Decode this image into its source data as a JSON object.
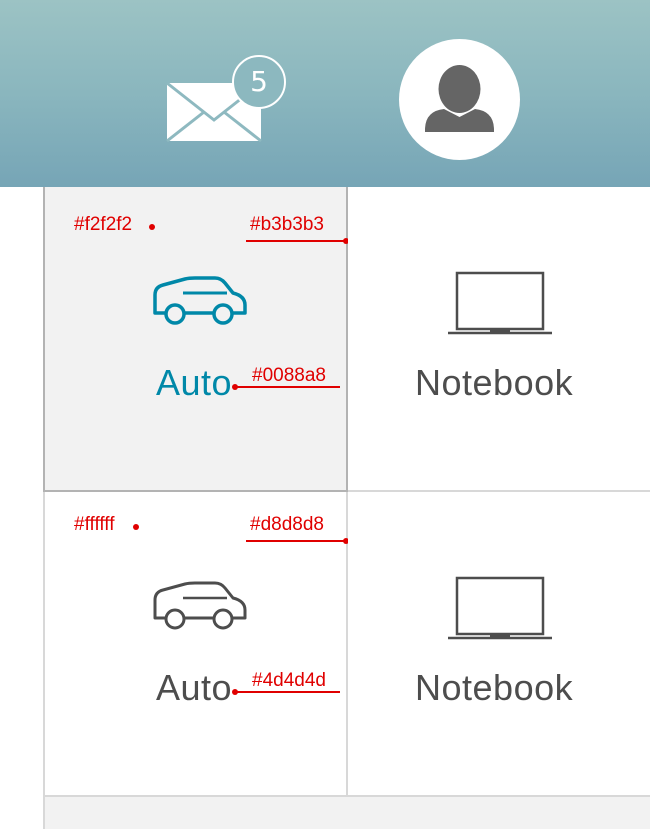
{
  "header": {
    "mail_badge_count": "5",
    "mail_icon": "envelope-icon",
    "avatar_icon": "user-silhouette-icon"
  },
  "tiles": [
    {
      "label": "Auto",
      "icon": "car-icon",
      "state": "selected",
      "label_color": "#0088a8"
    },
    {
      "label": "Notebook",
      "icon": "laptop-icon",
      "state": "normal",
      "label_color": "#4d4d4d"
    },
    {
      "label": "Auto",
      "icon": "car-icon",
      "state": "normal",
      "label_color": "#4d4d4d"
    },
    {
      "label": "Notebook",
      "icon": "laptop-icon",
      "state": "normal",
      "label_color": "#4d4d4d"
    }
  ],
  "annotations": {
    "selected_bg": "#f2f2f2",
    "selected_border": "#b3b3b3",
    "selected_text": "#0088a8",
    "normal_bg": "#ffffff",
    "normal_border": "#d8d8d8",
    "normal_text": "#4d4d4d"
  },
  "colors": {
    "header_top": "#9cc3c4",
    "header_bottom": "#76a5b6",
    "annotation_red": "#e00000"
  }
}
